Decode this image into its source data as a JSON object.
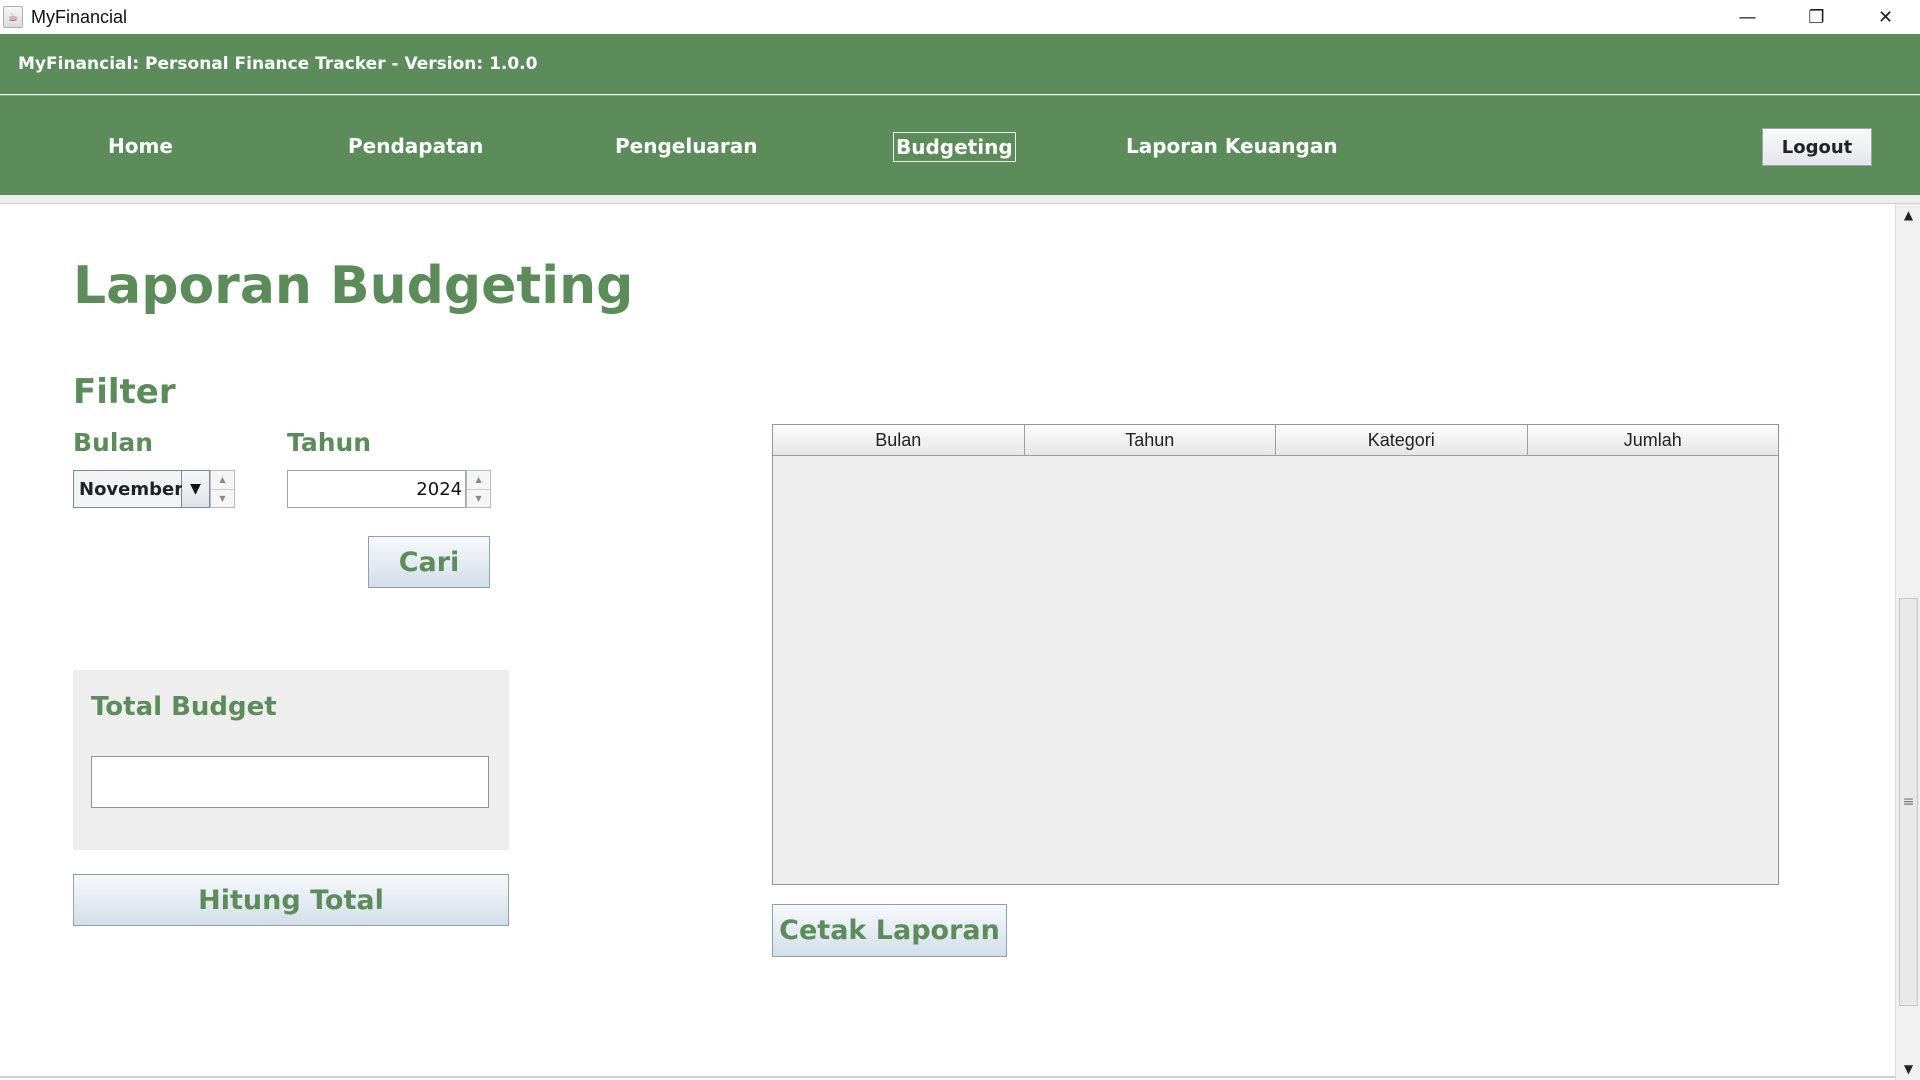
{
  "window": {
    "title": "MyFinancial",
    "minimize_glyph": "—",
    "restore_glyph": "❐",
    "close_glyph": "✕"
  },
  "header": {
    "text": "MyFinancial: Personal Finance Tracker - Version: 1.0.0"
  },
  "nav": {
    "items": [
      {
        "label": "Home"
      },
      {
        "label": "Pendapatan"
      },
      {
        "label": "Pengeluaran"
      },
      {
        "label": "Budgeting"
      },
      {
        "label": "Laporan Keuangan"
      }
    ],
    "active": "Budgeting",
    "logout_label": "Logout"
  },
  "page": {
    "title": "Laporan Budgeting"
  },
  "filter": {
    "title": "Filter",
    "bulan_label": "Bulan",
    "tahun_label": "Tahun",
    "bulan_value": "November",
    "tahun_value": "2024",
    "cari_label": "Cari"
  },
  "total": {
    "title": "Total Budget",
    "value": "",
    "hitung_label": "Hitung Total"
  },
  "table": {
    "columns": [
      "Bulan",
      "Tahun",
      "Kategori",
      "Jumlah"
    ],
    "rows": []
  },
  "actions": {
    "cetak_label": "Cetak Laporan"
  },
  "colors": {
    "brand_green": "#5b8c5a",
    "panel_gray": "#eeeeee"
  },
  "icons": {
    "app": "java-cup-icon",
    "dropdown": "chevron-down-icon",
    "spinner_up": "arrow-up-icon",
    "spinner_down": "arrow-down-icon"
  }
}
